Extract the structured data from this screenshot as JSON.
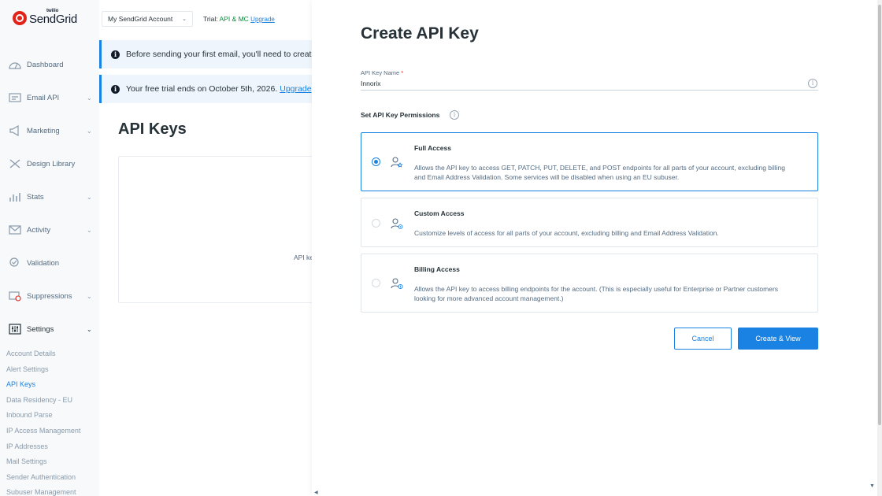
{
  "brand": {
    "small": "twilio",
    "name": "SendGrid"
  },
  "topbar": {
    "account": "My SendGrid Account",
    "trial_prefix": "Trial:",
    "trial_plan": "API & MC",
    "trial_link": "Upgrade"
  },
  "banners": {
    "first": "Before sending your first email, you'll need to create a",
    "second": "Your free trial ends on October 5th, 2026.",
    "second_link": "Upgrade"
  },
  "sidebar": {
    "items": [
      {
        "label": "Dashboard",
        "icon": "dashboard-icon",
        "chevron": false
      },
      {
        "label": "Email API",
        "icon": "email-api-icon",
        "chevron": true
      },
      {
        "label": "Marketing",
        "icon": "megaphone-icon",
        "chevron": true
      },
      {
        "label": "Design Library",
        "icon": "design-tools-icon",
        "chevron": false
      },
      {
        "label": "Stats",
        "icon": "stats-icon",
        "chevron": true
      },
      {
        "label": "Activity",
        "icon": "envelope-icon",
        "chevron": true
      },
      {
        "label": "Validation",
        "icon": "validation-icon",
        "chevron": false
      },
      {
        "label": "Suppressions",
        "icon": "suppression-icon",
        "chevron": true
      },
      {
        "label": "Settings",
        "icon": "settings-sliders-icon",
        "chevron": true
      }
    ],
    "sub_items": [
      "Account Details",
      "Alert Settings",
      "API Keys",
      "Data Residency - EU",
      "Inbound Parse",
      "IP Access Management",
      "IP Addresses",
      "Mail Settings",
      "Sender Authentication",
      "Subuser Management"
    ],
    "current_sub": "API Keys"
  },
  "main": {
    "title": "API Keys",
    "card_text": "API ke"
  },
  "modal": {
    "title": "Create API Key",
    "name_label": "API Key Name",
    "required_mark": "*",
    "name_value": "Innorix",
    "permissions_heading": "Set API Key Permissions",
    "options": [
      {
        "title": "Full Access",
        "description": "Allows the API key to access GET, PATCH, PUT, DELETE, and POST endpoints for all parts of your account, excluding billing and Email Address Validation. Some services will be disabled when using an EU subuser.",
        "icon": "user-star-icon",
        "selected": true
      },
      {
        "title": "Custom Access",
        "description": "Customize levels of access for all parts of your account, excluding billing and Email Address Validation.",
        "icon": "user-gear-icon",
        "selected": false
      },
      {
        "title": "Billing Access",
        "description": "Allows the API key to access billing endpoints for the account. (This is especially useful for Enterprise or Partner customers looking for more advanced account management.)",
        "icon": "user-card-icon",
        "selected": false
      }
    ],
    "cancel_label": "Cancel",
    "create_label": "Create & View"
  },
  "colors": {
    "accent": "#1a82e2",
    "text": "#263238",
    "muted": "#546b81",
    "required": "#e2231a",
    "sidebar_bg": "#f7f9fb",
    "banner_bg": "#eef5fc"
  }
}
